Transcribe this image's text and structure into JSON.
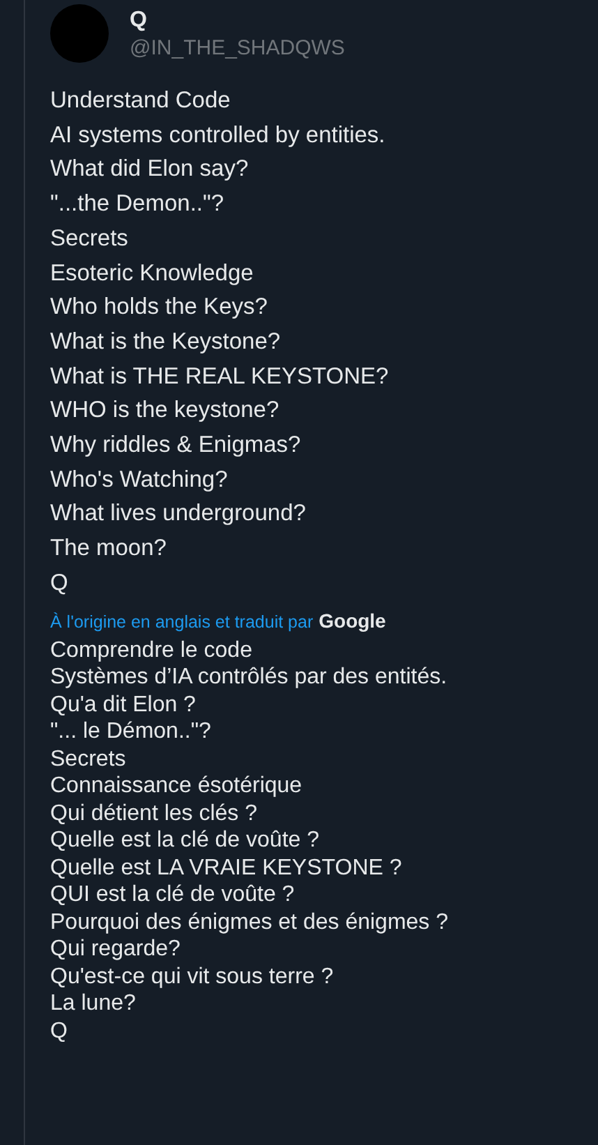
{
  "author": {
    "name": "Q",
    "handle": "@IN_THE_SHADQWS"
  },
  "original_lines": [
    "Understand Code",
    "AI systems controlled by entities.",
    "What did Elon say?",
    "\"...the Demon..\"?",
    "Secrets",
    "Esoteric Knowledge",
    "Who holds the Keys?",
    "What is the Keystone?",
    "What is THE REAL KEYSTONE?",
    "WHO is the keystone?",
    "Why riddles & Enigmas?",
    "Who's Watching?",
    "What lives underground?",
    "The moon?",
    "Q"
  ],
  "translation": {
    "note": "À l'origine en anglais et traduit par",
    "provider": "Google"
  },
  "translated_lines": [
    "Comprendre le code",
    "Systèmes d’IA contrôlés par des entités.",
    "Qu'a dit Elon ?",
    "\"... le Démon..\"?",
    "Secrets",
    "Connaissance ésotérique",
    "Qui détient les clés ?",
    "Quelle est la clé de voûte ?",
    "Quelle est LA VRAIE KEYSTONE ?",
    "QUI est la clé de voûte ?",
    "Pourquoi des énigmes et des énigmes ?",
    "Qui regarde?",
    "Qu'est-ce qui vit sous terre ?",
    "La lune?",
    "Q"
  ]
}
